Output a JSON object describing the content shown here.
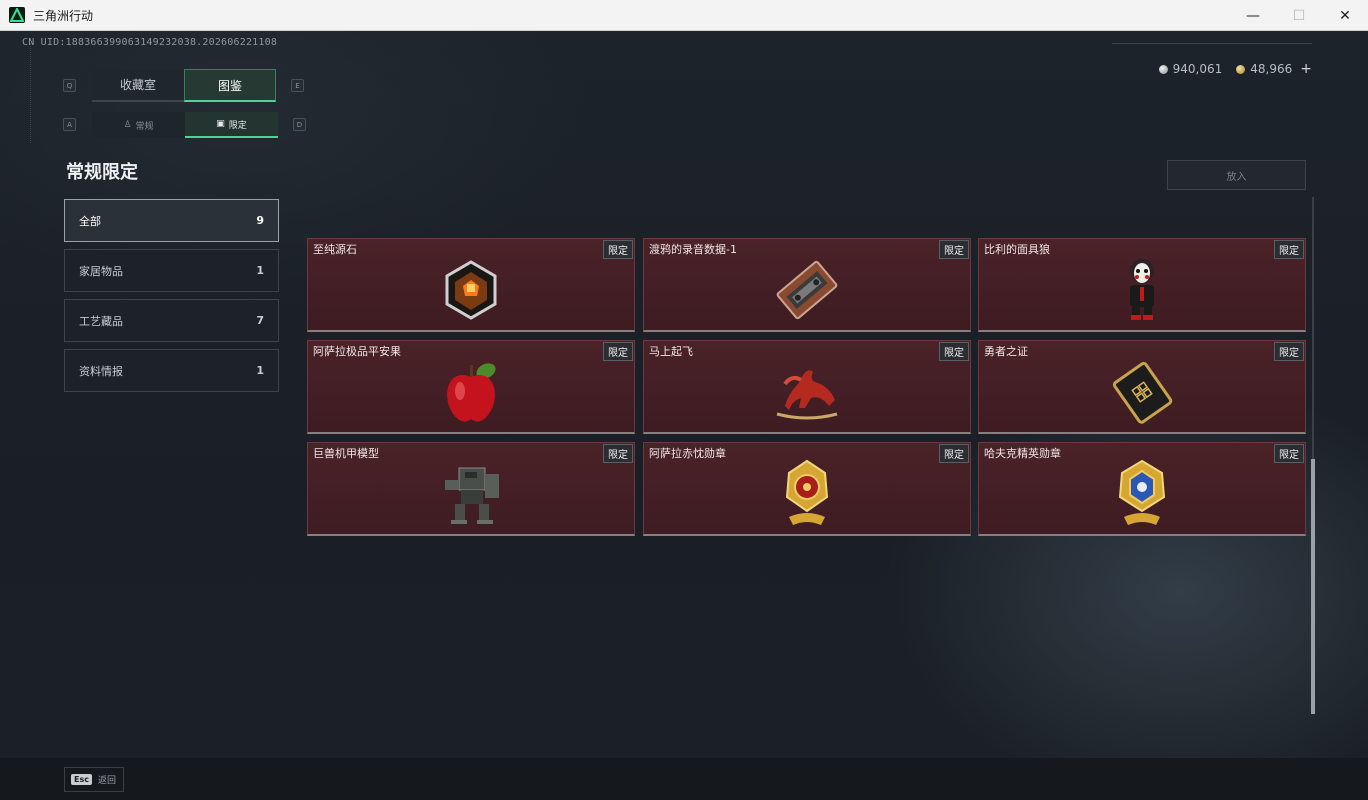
{
  "window": {
    "title": "三角洲行动",
    "minimize": "—",
    "maximize": "☐",
    "close": "✕"
  },
  "header": {
    "uid": "CN UID:1883663990631492320​38.202606221108",
    "currency": [
      {
        "icon": "silver-coin-icon",
        "value": "940,061"
      },
      {
        "icon": "gold-coin-icon",
        "value": "48,966"
      }
    ],
    "add_label": "+"
  },
  "tabs_primary": {
    "left_key": "Q",
    "right_key": "E",
    "items": [
      {
        "label": "收藏室",
        "active": false
      },
      {
        "label": "图鉴",
        "active": true
      }
    ]
  },
  "tabs_secondary": {
    "left_key": "A",
    "right_key": "D",
    "items": [
      {
        "label": "常规",
        "icon": "figure-icon",
        "active": false
      },
      {
        "label": "限定",
        "icon": "picture-icon",
        "active": true
      }
    ]
  },
  "section_title": "常规限定",
  "categories": [
    {
      "label": "全部",
      "count": "9",
      "active": true
    },
    {
      "label": "家居物品",
      "count": "1",
      "active": false
    },
    {
      "label": "工艺藏品",
      "count": "7",
      "active": false
    },
    {
      "label": "资料情报",
      "count": "1",
      "active": false
    }
  ],
  "put_button": "放入",
  "items": [
    {
      "name": "至纯源石",
      "badge": "限定",
      "art": "gem-icon"
    },
    {
      "name": "渡鸦的录音数据-1",
      "badge": "限定",
      "art": "cassette-icon"
    },
    {
      "name": "比利的面具狼",
      "badge": "限定",
      "art": "puppet-icon"
    },
    {
      "name": "阿萨拉极品平安果",
      "badge": "限定",
      "art": "apple-icon"
    },
    {
      "name": "马上起飞",
      "badge": "限定",
      "art": "horse-icon"
    },
    {
      "name": "勇者之证",
      "badge": "限定",
      "art": "card-icon"
    },
    {
      "name": "巨兽机甲模型",
      "badge": "限定",
      "art": "mech-icon"
    },
    {
      "name": "阿萨拉赤忱勋章",
      "badge": "限定",
      "art": "red-medal-icon"
    },
    {
      "name": "哈夫克精英勋章",
      "badge": "限定",
      "art": "blue-medal-icon"
    }
  ],
  "bottom": {
    "esc_key": "Esc",
    "back_label": "返回"
  },
  "colors": {
    "accent": "#4fd39a",
    "card_bg": "#4a2228"
  }
}
